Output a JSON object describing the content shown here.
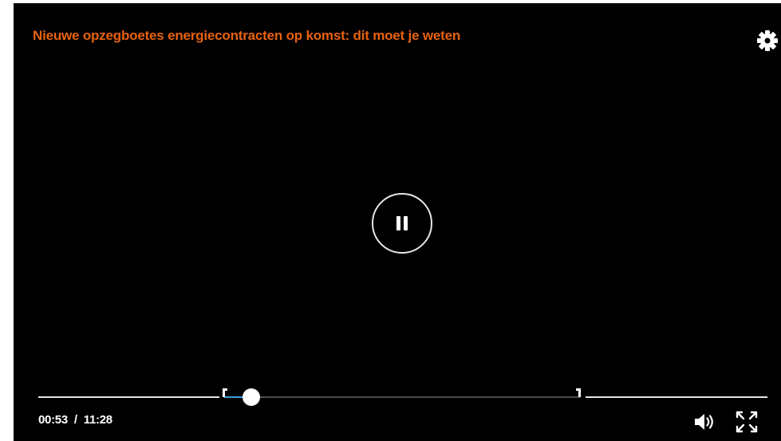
{
  "video": {
    "title": "Nieuwe opzegboetes energiecontracten op komst: dit moet je weten",
    "state": "playing",
    "center_control_icon": "pause-icon",
    "current_time": "00:53",
    "separator": "/",
    "duration": "11:28",
    "chapter_progress_fraction": 0.06
  },
  "controls": {
    "settings_icon": "gear-icon",
    "volume_icon": "volume-icon",
    "fullscreen_icon": "fullscreen-icon"
  },
  "colors": {
    "title": "#e8620e",
    "background": "#000000",
    "played": "#3b9fd8"
  }
}
